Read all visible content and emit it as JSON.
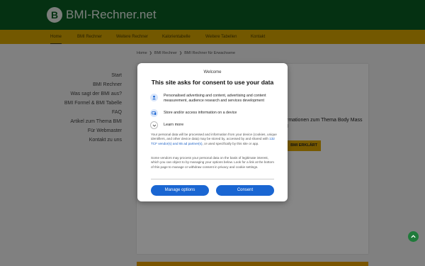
{
  "header": {
    "logo_letter": "B",
    "site_title": "BMI-Rechner.net"
  },
  "nav": {
    "items": [
      {
        "label": "Home",
        "active": true
      },
      {
        "label": "BMI Rechner"
      },
      {
        "label": "Weitere Rechner"
      },
      {
        "label": "Kalorientabelle"
      },
      {
        "label": "Weitere Tabellen"
      },
      {
        "label": "Kontakt"
      }
    ]
  },
  "breadcrumb": {
    "items": [
      "Home",
      "BMI Rechner",
      "BMI Rechner für Erwachsene"
    ],
    "separator": "❯"
  },
  "sidebar": {
    "links": [
      "Start",
      "BMI Rechner",
      "Was sagt der BMI aus?",
      "BMI Formel & BMI Tabelle",
      "FAQ",
      "Artikel zum Thema BMI",
      "Für Webmaster",
      "Kontakt zu uns"
    ]
  },
  "main": {
    "partial_text": "rmationen zum Thema Body Mass\nI",
    "partial_button": "BMI ERKLÄRT"
  },
  "consent": {
    "welcome": "Welcome",
    "title": "This site asks for consent to use your data",
    "purposes": [
      {
        "icon": "person-icon",
        "text": "Personalised advertising and content, advertising and content measurement, audience research and services development"
      },
      {
        "icon": "device-icon",
        "text": "Store and/or access information on a device"
      }
    ],
    "learn_more": "Learn more",
    "learn_more_icon": "chevron-down-icon",
    "body1_pre": "Your personal data will be processed and information from your device (cookies, unique identifiers, and other device data) may be stored by, accessed by and shared with ",
    "body1_link": "132 TCF vendor(s) and 65 ad partner(s)",
    "body1_post": ", or used specifically by this site or app.",
    "body2": "Some vendors may process your personal data on the basis of legitimate interest, which you can object to by managing your options below. Look for a link at the bottom of this page to manage or withdraw consent in privacy and cookie settings.",
    "manage_button": "Manage options",
    "consent_button": "Consent"
  },
  "scroll_top_icon": "arrow-up-icon",
  "colors": {
    "header_green": "#0a5e22",
    "nav_yellow": "#d9a700",
    "consent_blue": "#1a66d2"
  }
}
